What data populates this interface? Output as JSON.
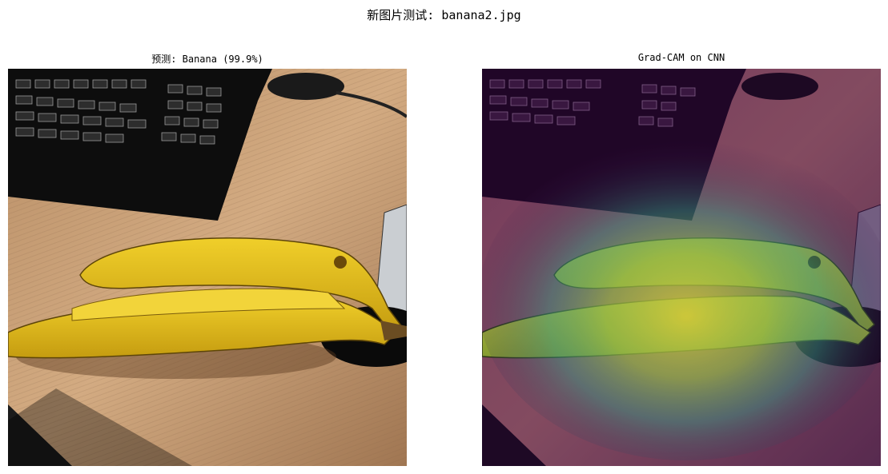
{
  "figure": {
    "suptitle": "新图片测试: banana2.jpg",
    "panels": [
      {
        "title": "预测: Banana (99.9%)",
        "image": "banana-photo"
      },
      {
        "title": "Grad-CAM on CNN",
        "image": "banana-gradcam-overlay"
      }
    ]
  },
  "colors": {
    "desk": "#c9a078",
    "banana": "#e8c21a",
    "keyboard": "#111111",
    "cam_low": "#3b0a45",
    "cam_high": "#d8e83a"
  }
}
